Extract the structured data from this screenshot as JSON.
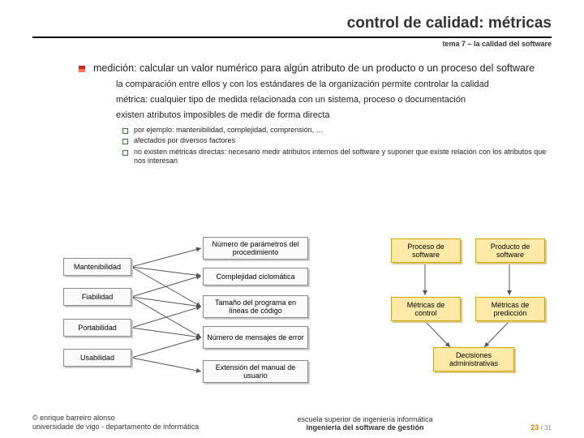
{
  "header": {
    "title": "control de calidad: métricas",
    "subtitle": "tema 7 – la calidad del software"
  },
  "bullets": {
    "main": "medición: calcular un valor numérico para algún atributo de un producto o un proceso del software",
    "sub": [
      "la comparación entre ellos y con los estándares de la organización permite controlar la calidad",
      "métrica: cualquier tipo de medida relacionada con un sistema, proceso o documentación",
      "existen atributos imposibles de medir de forma directa"
    ],
    "sub2": [
      "por ejemplo: mantenibilidad, complejidad, comprensión, …",
      "afectados por diversos factores",
      "no existen métricas directas: necesario medir atributos internos del software y suponer que existe relación con los atributos que nos interesan"
    ]
  },
  "diagram": {
    "left": [
      "Mantenibilidad",
      "Fiabilidad",
      "Portabilidad",
      "Usabilidad"
    ],
    "mid": [
      "Número de parámetros del procedimiento",
      "Complejidad ciclomática",
      "Tamaño del programa en líneas de código",
      "Número de mensajes de error",
      "Extensión del manual de usuario"
    ],
    "right": [
      "Proceso de software",
      "Producto de software",
      "Métricas de control",
      "Métricas de predicción",
      "Decisiones administrativas"
    ]
  },
  "footer": {
    "left1": "© enrique barreiro alonso",
    "left2": "universidade de vigo - departamento de informática",
    "ctr1": "escuela superior de ingeniería informática",
    "ctr2": "ingeniería del software de gestión",
    "page_cur": "23",
    "page_sep": " / ",
    "page_tot": "31"
  }
}
